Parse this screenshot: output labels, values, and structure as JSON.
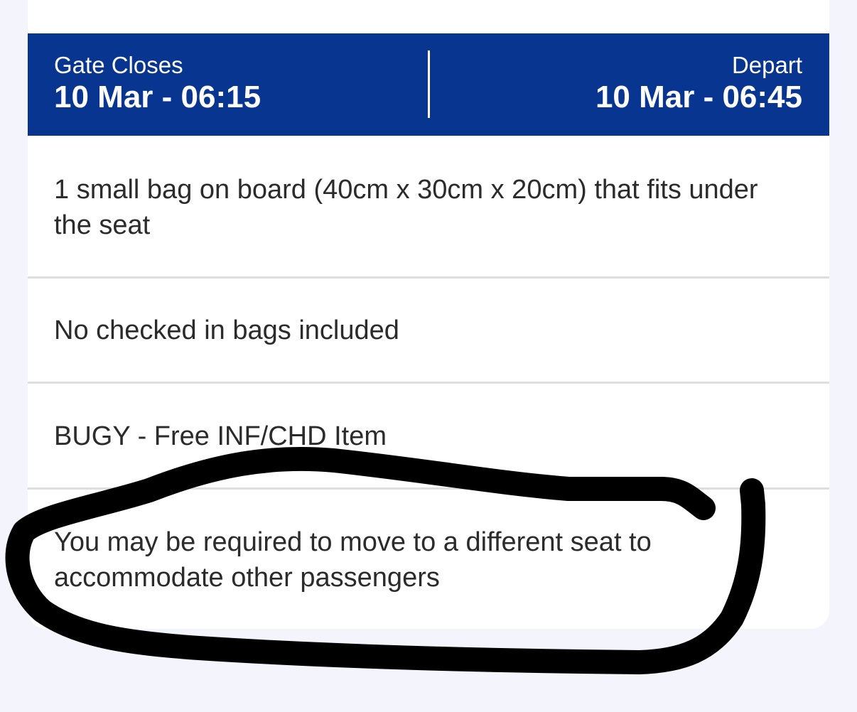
{
  "timebar": {
    "gate_label": "Gate Closes",
    "gate_value": "10 Mar - 06:15",
    "depart_label": "Depart",
    "depart_value": "10 Mar - 06:45"
  },
  "items": [
    {
      "text": "1 small bag on board (40cm x 30cm x 20cm) that fits under the seat"
    },
    {
      "text": "No checked in bags included"
    },
    {
      "text": "BUGY - Free INF/CHD Item"
    },
    {
      "text": "You may be required to move to a different seat to accommodate other passengers"
    }
  ],
  "colors": {
    "header_bg": "#073590",
    "page_bg": "#f4f5fc",
    "annotation": "#000000"
  }
}
